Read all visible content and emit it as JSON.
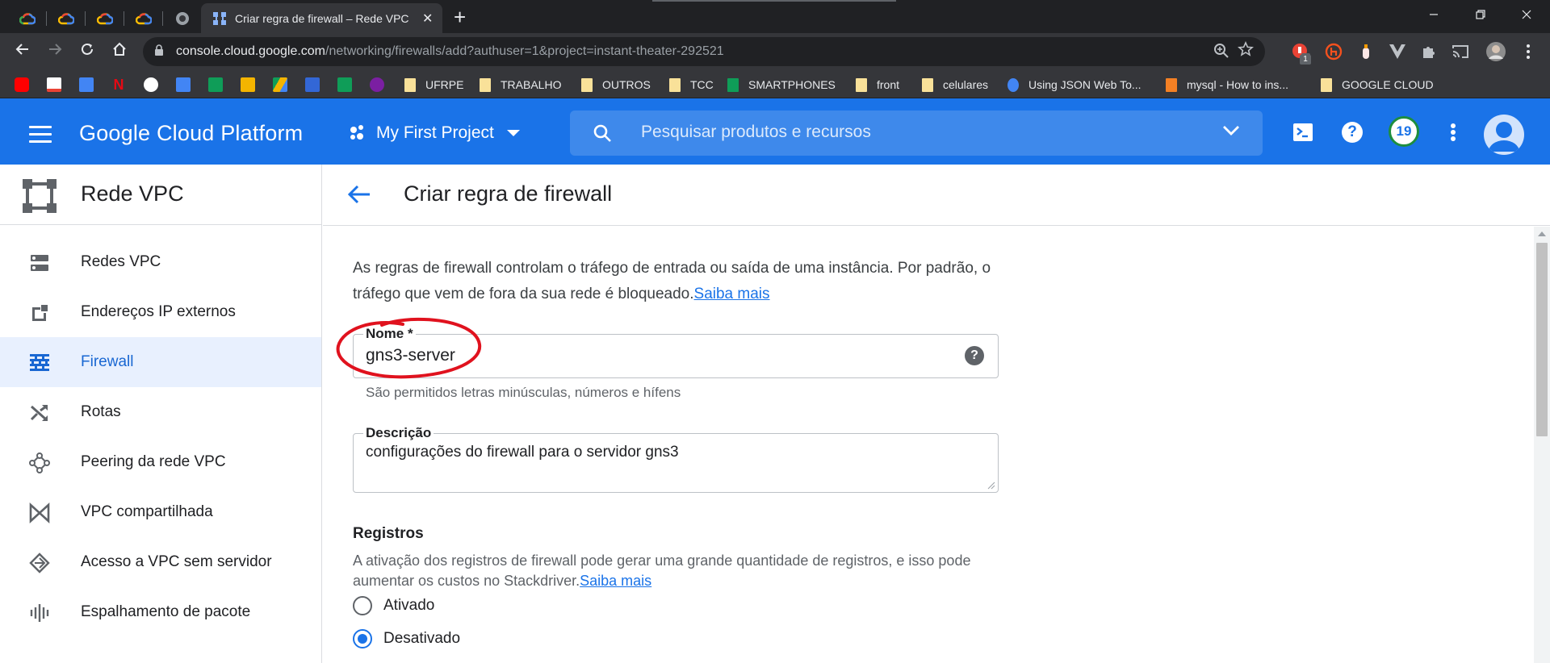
{
  "browser": {
    "active_tab_title": "Criar regra de firewall – Rede VPC",
    "tab_close": "✕",
    "new_tab": "+",
    "url_host": "console.cloud.google.com",
    "url_path": "/networking/firewalls/add?authuser=1&project=instant-theater-292521",
    "ext_badge": "1",
    "bookmarks": [
      "UFRPE",
      "TRABALHO",
      "OUTROS",
      "TCC",
      "SMARTPHONES",
      "front",
      "celulares",
      "Using JSON Web To...",
      "mysql - How to ins...",
      "GOOGLE CLOUD"
    ]
  },
  "header": {
    "logo": "Google Cloud Platform",
    "project": "My First Project",
    "search_placeholder": "Pesquisar produtos e recursos",
    "notifications_count": "19",
    "help": "?"
  },
  "sidenav": {
    "title": "Rede VPC",
    "items": [
      {
        "label": "Redes VPC",
        "icon": "vpc-networks-icon"
      },
      {
        "label": "Endereços IP externos",
        "icon": "external-ip-icon"
      },
      {
        "label": "Firewall",
        "icon": "firewall-icon"
      },
      {
        "label": "Rotas",
        "icon": "routes-icon"
      },
      {
        "label": "Peering da rede VPC",
        "icon": "peering-icon"
      },
      {
        "label": "VPC compartilhada",
        "icon": "shared-vpc-icon"
      },
      {
        "label": "Acesso a VPC sem servidor",
        "icon": "serverless-access-icon"
      },
      {
        "label": "Espalhamento de pacote",
        "icon": "packet-mirroring-icon"
      }
    ],
    "active_index": 2
  },
  "main": {
    "title": "Criar regra de firewall",
    "intro": "As regras de firewall controlam o tráfego de entrada ou saída de uma instância. Por padrão, o tráfego que vem de fora da sua rede é bloqueado.",
    "learn_more": "Saiba mais",
    "name_label": "Nome *",
    "name_value": "gns3-server",
    "name_hint": "São permitidos letras minúsculas, números e hífens",
    "desc_label": "Descrição",
    "desc_value": "configurações do firewall para o servidor gns3",
    "logs_title": "Registros",
    "logs_desc": "A ativação dos registros de firewall pode gerar uma grande quantidade de registros, e isso pode aumentar os custos no Stackdriver.",
    "logs_learn_more": "Saiba mais",
    "logs_options": [
      {
        "label": "Ativado",
        "selected": false
      },
      {
        "label": "Desativado",
        "selected": true
      }
    ]
  },
  "colors": {
    "gcp_blue": "#1a73e8",
    "annotation_red": "#e0121e"
  }
}
